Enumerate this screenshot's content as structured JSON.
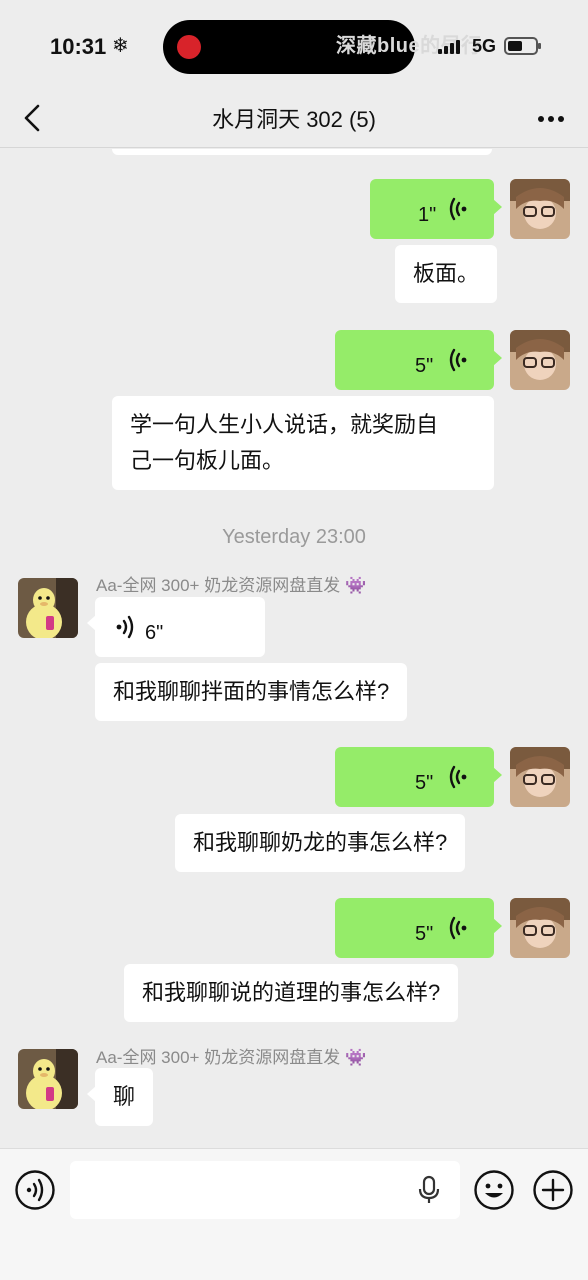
{
  "status_bar": {
    "time": "10:31",
    "weather_glyph": "❄",
    "watermark": "深藏blue的昼行",
    "network": "5G"
  },
  "header": {
    "title": "水月洞天 302 (5)",
    "back_icon": "chevron-left-icon",
    "more_icon": "more-dots-icon"
  },
  "messages": [
    {
      "id": "m1",
      "side": "right",
      "type": "voice",
      "duration": "1\""
    },
    {
      "id": "m2",
      "side": "right",
      "type": "text",
      "text": "板面。"
    },
    {
      "id": "m3",
      "side": "right",
      "type": "voice",
      "duration": "5\""
    },
    {
      "id": "m4",
      "side": "right",
      "type": "text",
      "line1": "学一句人生小人说话，就奖励自",
      "line2": "己一句板儿面。"
    },
    {
      "id": "ts1",
      "type": "timestamp",
      "text": "Yesterday 23:00"
    },
    {
      "id": "m5",
      "side": "left",
      "sender": "Aa-全网 300+ 奶龙资源网盘直发",
      "sender_emoji": "👾",
      "type": "voice",
      "duration": "6\""
    },
    {
      "id": "m6",
      "side": "left",
      "type": "text",
      "text": "和我聊聊拌面的事情怎么样?"
    },
    {
      "id": "m7",
      "side": "right",
      "type": "voice",
      "duration": "5\""
    },
    {
      "id": "m8",
      "side": "right",
      "type": "text",
      "text": "和我聊聊奶龙的事怎么样?"
    },
    {
      "id": "m9",
      "side": "right",
      "type": "voice",
      "duration": "5\""
    },
    {
      "id": "m10",
      "side": "right",
      "type": "text",
      "text": "和我聊聊说的道理的事怎么样?"
    },
    {
      "id": "m11",
      "side": "left",
      "sender": "Aa-全网 300+ 奶龙资源网盘直发",
      "sender_emoji": "👾",
      "type": "text",
      "text": "聊"
    }
  ],
  "input_bar": {
    "voice_icon": "voice-mode-icon",
    "placeholder": "",
    "mic_icon": "microphone-icon",
    "emoji_icon": "emoji-icon",
    "plus_icon": "plus-icon"
  },
  "colors": {
    "background": "#ededed",
    "sent_bubble": "#95ec69",
    "received_bubble": "#ffffff",
    "timestamp": "#9a9a9a"
  }
}
